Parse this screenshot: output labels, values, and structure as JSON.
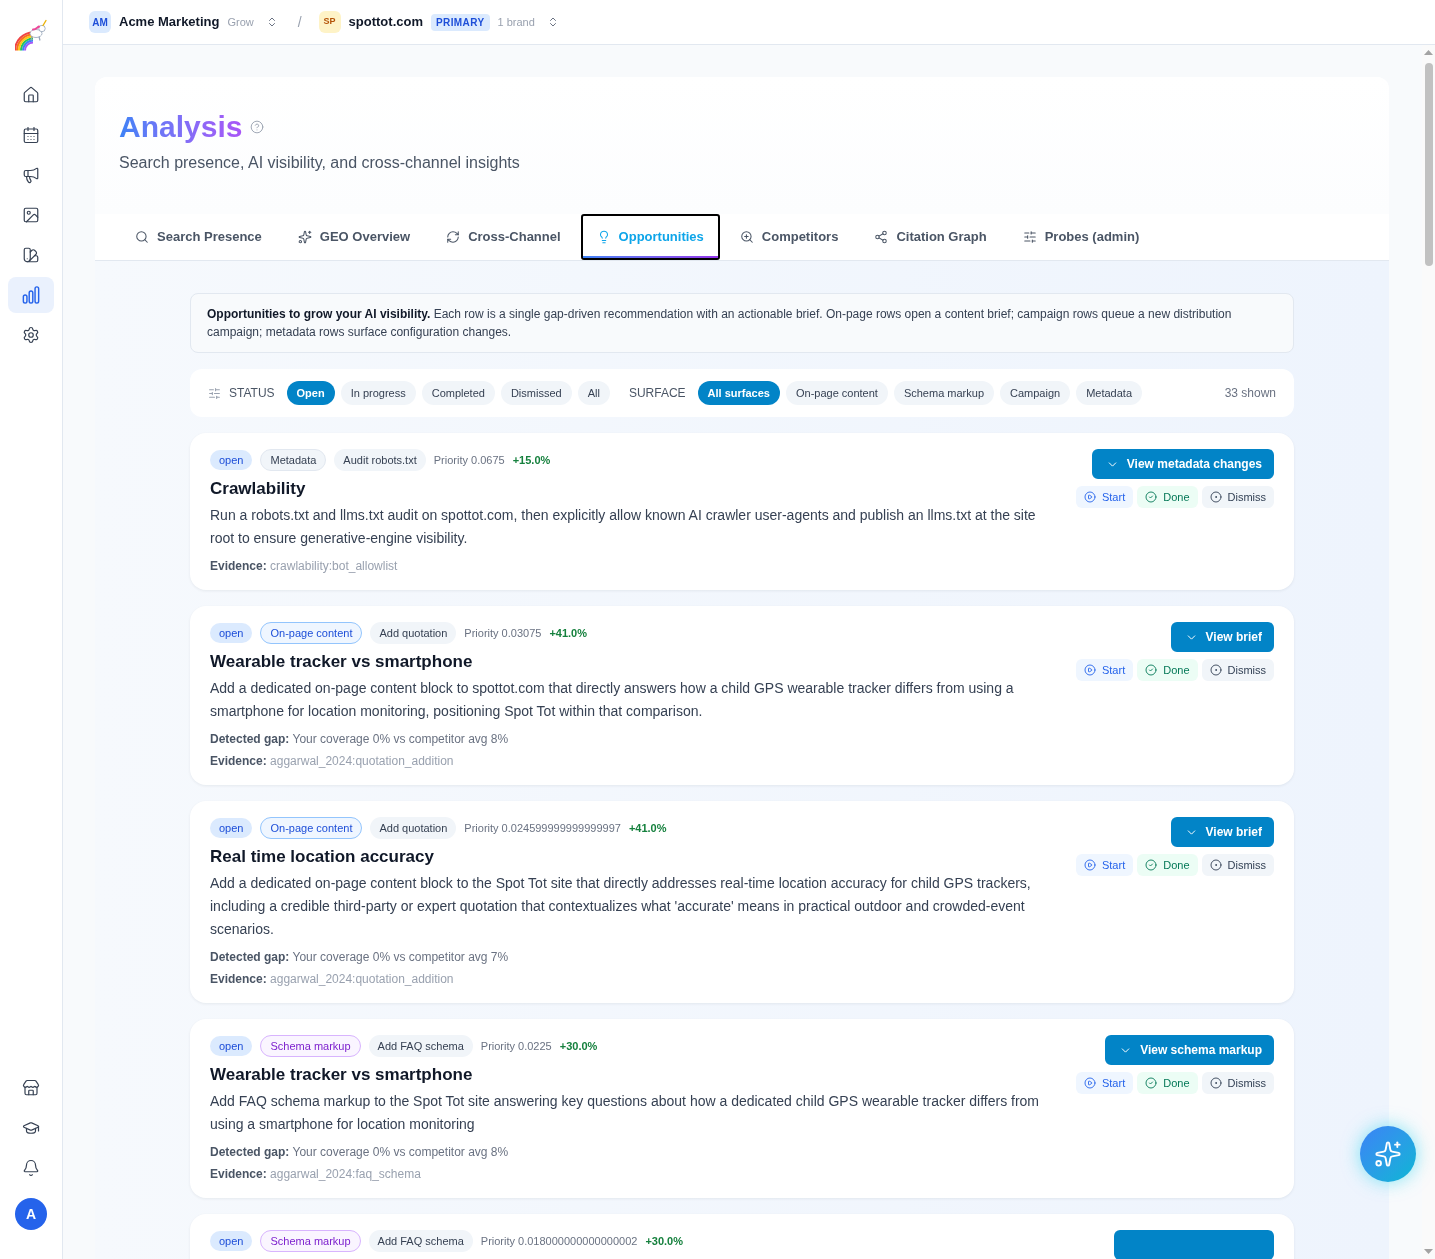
{
  "sidebar": {
    "top_items": [
      {
        "selected": false
      },
      {
        "selected": false
      },
      {
        "selected": false
      },
      {
        "selected": false
      },
      {
        "selected": false
      },
      {
        "selected": true
      },
      {
        "selected": false
      }
    ],
    "bottom_items": [
      {
        "selected": false
      },
      {
        "selected": false
      },
      {
        "selected": false
      }
    ],
    "avatar": "A"
  },
  "topbar": {
    "org": {
      "badge": "AM",
      "name": "Acme Marketing",
      "plan": "Grow"
    },
    "separator": "/",
    "brand": {
      "badge": "SP",
      "name": "spottot.com",
      "tag": "PRIMARY",
      "count": "1 brand"
    }
  },
  "header": {
    "title": "Analysis",
    "subtitle": "Search presence, AI visibility, and cross-channel insights"
  },
  "tabs": [
    {
      "label": "Search Presence",
      "selected": false
    },
    {
      "label": "GEO Overview",
      "selected": false
    },
    {
      "label": "Cross-Channel",
      "selected": false
    },
    {
      "label": "Opportunities",
      "selected": true
    },
    {
      "label": "Competitors",
      "selected": false
    },
    {
      "label": "Citation Graph",
      "selected": false
    },
    {
      "label": "Probes (admin)",
      "selected": false
    }
  ],
  "intro": "**Opportunities to grow your AI visibility.** Each row is a single gap-driven recommendation with an actionable brief. On-page rows open a content brief; campaign rows queue a new distribution campaign; metadata rows surface configuration changes.",
  "filters": {
    "status_label": "STATUS",
    "status_options": [
      {
        "label": "Open",
        "selected": true
      },
      {
        "label": "In progress",
        "selected": false
      },
      {
        "label": "Completed",
        "selected": false
      },
      {
        "label": "Dismissed",
        "selected": false
      },
      {
        "label": "All",
        "selected": false
      }
    ],
    "surface_label": "SURFACE",
    "surface_options": [
      {
        "label": "All surfaces",
        "selected": true
      },
      {
        "label": "On-page content",
        "selected": false
      },
      {
        "label": "Schema markup",
        "selected": false
      },
      {
        "label": "Campaign",
        "selected": false
      },
      {
        "label": "Metadata",
        "selected": false
      }
    ],
    "count": "33 shown"
  },
  "cards": [
    {
      "status": "open",
      "surface": {
        "label": "Metadata",
        "kind": "metadata"
      },
      "action": "Audit robots.txt",
      "priority": "Priority 0.0675",
      "lift": "+15.0%",
      "title": "Crawlability",
      "description": "Run a robots.txt and llms.txt audit on spottot.com, then explicitly allow known AI crawler user-agents and publish an llms.txt at the site root to ensure generative-engine visibility.",
      "evidence": {
        "label": "Evidence:",
        "value": "crawlability:bot_allowlist"
      },
      "primary_action": "View metadata changes",
      "actions": [
        {
          "label": "Start",
          "kind": "start"
        },
        {
          "label": "Done",
          "kind": "done"
        },
        {
          "label": "Dismiss",
          "kind": "dismiss"
        }
      ]
    },
    {
      "status": "open",
      "surface": {
        "label": "On-page content",
        "kind": "on_page"
      },
      "action": "Add quotation",
      "priority": "Priority 0.03075",
      "lift": "+41.0%",
      "title": "Wearable tracker vs smartphone",
      "description": "Add a dedicated on-page content block to spottot.com that directly answers how a child GPS wearable tracker differs from using a smartphone for location monitoring, positioning Spot Tot within that comparison.",
      "gap": {
        "label": "Detected gap:",
        "value": "Your coverage 0% vs competitor avg 8%"
      },
      "evidence": {
        "label": "Evidence:",
        "value": "aggarwal_2024:quotation_addition"
      },
      "primary_action": "View brief",
      "actions": [
        {
          "label": "Start",
          "kind": "start"
        },
        {
          "label": "Done",
          "kind": "done"
        },
        {
          "label": "Dismiss",
          "kind": "dismiss"
        }
      ]
    },
    {
      "status": "open",
      "surface": {
        "label": "On-page content",
        "kind": "on_page"
      },
      "action": "Add quotation",
      "priority": "Priority 0.024599999999999997",
      "lift": "+41.0%",
      "title": "Real time location accuracy",
      "description": "Add a dedicated on-page content block to the Spot Tot site that directly addresses real-time location accuracy for child GPS trackers, including a credible third-party or expert quotation that contextualizes what 'accurate' means in practical outdoor and crowded-event scenarios.",
      "gap": {
        "label": "Detected gap:",
        "value": "Your coverage 0% vs competitor avg 7%"
      },
      "evidence": {
        "label": "Evidence:",
        "value": "aggarwal_2024:quotation_addition"
      },
      "primary_action": "View brief",
      "actions": [
        {
          "label": "Start",
          "kind": "start"
        },
        {
          "label": "Done",
          "kind": "done"
        },
        {
          "label": "Dismiss",
          "kind": "dismiss"
        }
      ]
    },
    {
      "status": "open",
      "surface": {
        "label": "Schema markup",
        "kind": "schema"
      },
      "action": "Add FAQ schema",
      "priority": "Priority 0.0225",
      "lift": "+30.0%",
      "title": "Wearable tracker vs smartphone",
      "description": "Add FAQ schema markup to the Spot Tot site answering key questions about how a dedicated child GPS wearable tracker differs from using a smartphone for location monitoring",
      "gap": {
        "label": "Detected gap:",
        "value": "Your coverage 0% vs competitor avg 8%"
      },
      "evidence": {
        "label": "Evidence:",
        "value": "aggarwal_2024:faq_schema"
      },
      "primary_action": "View schema markup",
      "actions": [
        {
          "label": "Start",
          "kind": "start"
        },
        {
          "label": "Done",
          "kind": "done"
        },
        {
          "label": "Dismiss",
          "kind": "dismiss"
        }
      ]
    },
    {
      "status": "open",
      "surface": {
        "label": "Schema markup",
        "kind": "schema"
      },
      "action": "Add FAQ schema",
      "priority": "Priority 0.018000000000000002",
      "lift": "+30.0%"
    }
  ]
}
